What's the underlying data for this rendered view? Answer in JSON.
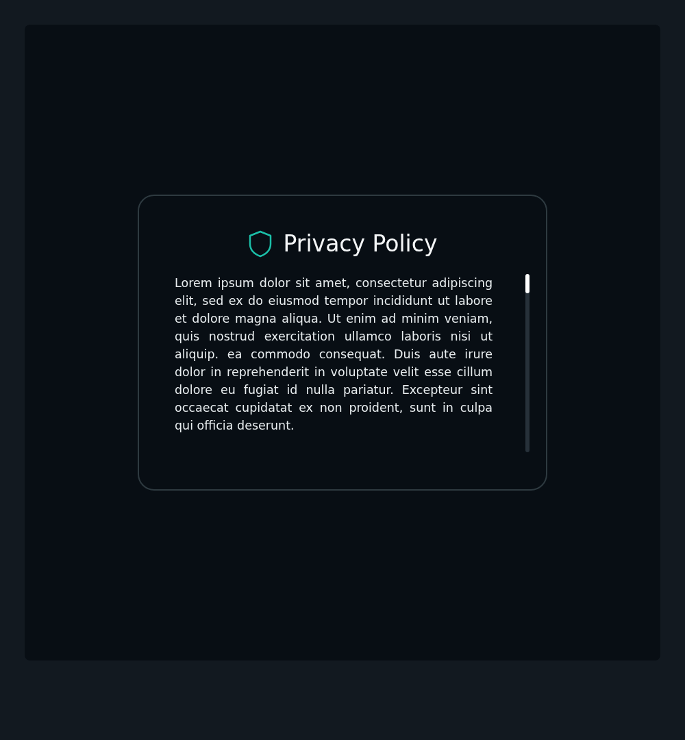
{
  "dialog": {
    "title": "Privacy Policy",
    "body": "Lorem ipsum dolor sit amet, consectetur adipiscing elit, sed ex do eiusmod tempor incididunt ut labore et dolore magna aliqua. Ut enim ad minim veniam, quis nostrud exercitation ullamco laboris nisi ut aliquip. ea commodo consequat. Duis aute irure dolor in reprehenderit in voluptate velit esse cillum dolore eu fugiat id nulla pariatur. Excepteur sint occaecat cupidatat ex non proident, sunt in culpa qui officia deserunt."
  }
}
